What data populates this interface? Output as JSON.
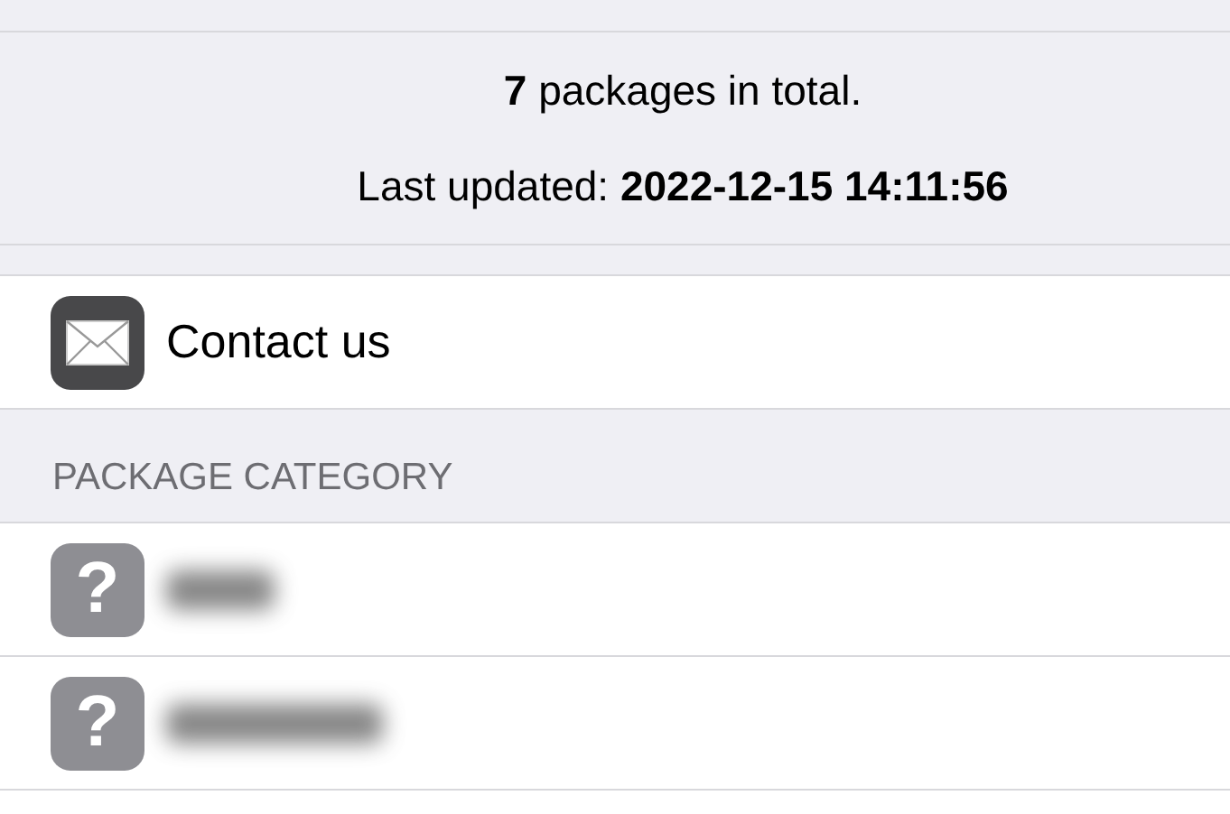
{
  "summary": {
    "count_line": "**7** packages in total.",
    "updated_line": "Last updated: **2022-12-15 14:11:56**"
  },
  "contact": {
    "label": "Contact us"
  },
  "section": {
    "title": "PACKAGE CATEGORY"
  },
  "categories": [
    {
      "icon": "?"
    },
    {
      "icon": "?"
    }
  ]
}
